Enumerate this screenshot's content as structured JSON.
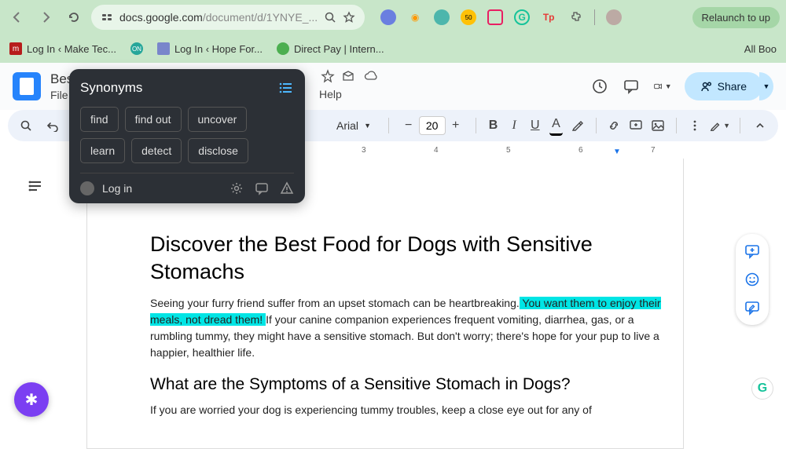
{
  "browser": {
    "url_host": "docs.google.com",
    "url_path": "/document/d/1YNYE_...",
    "relaunch": "Relaunch to up"
  },
  "bookmarks": {
    "b1": "Log In ‹ Make Tec...",
    "b2": "Log In ‹ Hope For...",
    "b3": "Direct Pay | Intern...",
    "all": "All Boo"
  },
  "docs": {
    "title": "Best",
    "menu_file": "File",
    "menu_help": "Help",
    "share": "Share",
    "font_name": "Arial",
    "font_size": "20"
  },
  "ruler": {
    "r3": "3",
    "r4": "4",
    "r5": "5",
    "r6": "6",
    "r7": "7"
  },
  "popup": {
    "title": "Synonyms",
    "s1": "find",
    "s2": "find out",
    "s3": "uncover",
    "s4": "learn",
    "s5": "detect",
    "s6": "disclose",
    "login": "Log in"
  },
  "doc": {
    "h1": "Discover the Best Food for Dogs with Sensitive Stomachs",
    "p1a": "Seeing your furry friend suffer from an upset stomach can be heartbreaking.",
    "p1b": " You want them to enjoy their meals, not dread them! ",
    "p1c": "If your canine companion experiences frequent vomiting, diarrhea, gas, or a rumbling tummy, they might have a sensitive stomach. But don't worry; there's hope for your pup to live a happier, healthier life.",
    "h2": "What are the Symptoms of a Sensitive Stomach in Dogs?",
    "p2": "If you are worried your dog is experiencing tummy troubles, keep a close eye out for any of"
  }
}
